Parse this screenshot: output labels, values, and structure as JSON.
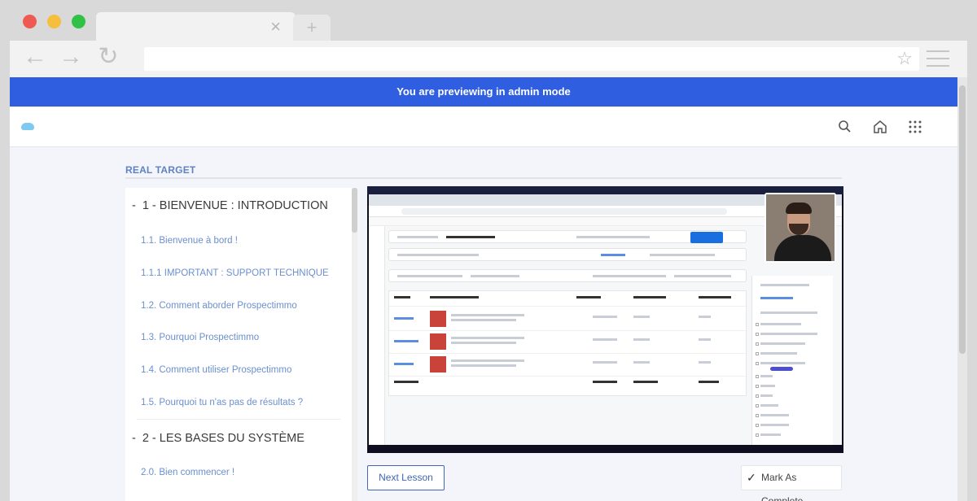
{
  "browser": {
    "tab_close": "×",
    "new_tab": "+",
    "back": "←",
    "forward": "→",
    "reload": "↻",
    "bookmark": "☆"
  },
  "banner": {
    "text": "You are previewing in admin mode"
  },
  "course": {
    "title": "REAL TARGET"
  },
  "sidebar": {
    "sections": [
      {
        "dash": "-",
        "title": "1 - BIENVENUE : INTRODUCTION",
        "lessons": [
          "1.1. Bienvenue à bord !",
          "1.1.1 IMPORTANT : SUPPORT TECHNIQUE",
          "1.2. Comment aborder Prospectimmo",
          "1.3. Pourquoi Prospectimmo",
          "1.4. Comment utiliser Prospectimmo",
          "1.5. Pourquoi tu n'as pas de résultats ?"
        ]
      },
      {
        "dash": "-",
        "title": "2 - LES BASES DU SYSTÈME",
        "lessons": [
          "2.0. Bien commencer !"
        ]
      }
    ]
  },
  "actions": {
    "next_label": "Next Lesson",
    "complete_label": "Mark As Complete",
    "complete_icon": "✓"
  },
  "icons": [
    "search-icon",
    "home-icon",
    "apps-grid-icon",
    "checkmark-icon"
  ],
  "colors": {
    "banner": "#2f5fe0",
    "link": "#6b8fcf",
    "accent": "#3f66b8"
  }
}
